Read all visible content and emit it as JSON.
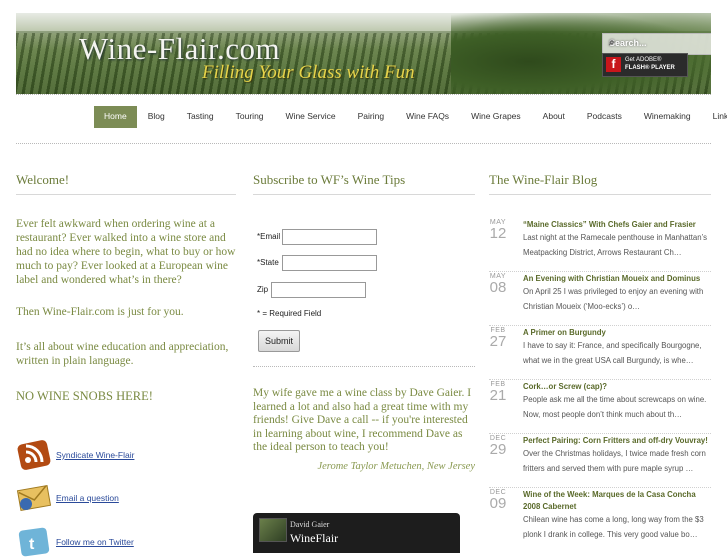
{
  "header": {
    "logo": "Wine-Flair.com",
    "tagline": "Filling Your Glass with Fun",
    "search_placeholder": "Search...",
    "flash_line1": "Get ADOBE®",
    "flash_line2": "FLASH® PLAYER"
  },
  "nav": [
    "Home",
    "Blog",
    "Tasting",
    "Touring",
    "Wine Service",
    "Pairing",
    "Wine FAQs",
    "Wine Grapes",
    "About",
    "Podcasts",
    "Winemaking",
    "Links"
  ],
  "welcome": {
    "heading": "Welcome!",
    "p1": "Ever felt awkward when ordering wine at a restaurant? Ever walked into a wine store and had no idea where to begin, what to buy or how much to pay? Ever looked at a European wine label and wondered what’s in there?",
    "p2": "Then Wine-Flair.com is just for you.",
    "p3": "It’s all about wine education and appreciation, written in plain language.",
    "p4": "NO WINE SNOBS HERE!",
    "links": [
      "Syndicate Wine-Flair",
      "Email a question",
      "Follow me on Twitter"
    ]
  },
  "subscribe": {
    "heading": "Subscribe to WF’s Wine Tips",
    "email_label": "*Email",
    "state_label": "*State",
    "zip_label": "Zip",
    "required_note": "* = Required Field",
    "submit": "Submit"
  },
  "testimonial": {
    "quote": "My wife gave me a wine class by Dave Gaier. I learned a lot and also had a great time with my friends! Give Dave a call -- if you're interested in learning about wine, I recommend Dave as the ideal person to teach you!",
    "source": "Jerome Taylor Metuchen, New Jersey"
  },
  "video": {
    "user": "David Gaier",
    "channel": "WineFlair"
  },
  "blog": {
    "heading": "The Wine-Flair Blog",
    "posts": [
      {
        "month": "MAY",
        "day": "12",
        "title": "“Maine Classics” With Chefs Gaier and Frasier",
        "excerpt": "Last night at the Ramecale penthouse in Manhattan’s Meatpacking District, Arrows Restaurant Ch…"
      },
      {
        "month": "MAY",
        "day": "08",
        "title": "An Evening with Christian Moueix and Dominus",
        "excerpt": "On April 25 I was privileged to enjoy an evening with Christian Moueix (‘Moo-ecks’) o…"
      },
      {
        "month": "FEB",
        "day": "27",
        "title": "A Primer on Burgundy",
        "excerpt": "I have to say it: France, and specifically Bourgogne, what we in the great USA call Burgundy, is whe…"
      },
      {
        "month": "FEB",
        "day": "21",
        "title": "Cork…or Screw (cap)?",
        "excerpt": "People ask me all the time about screwcaps on wine. Now, most people don’t think much about th…"
      },
      {
        "month": "DEC",
        "day": "29",
        "title": "Perfect Pairing: Corn Fritters and off-dry Vouvray!",
        "excerpt": "Over the Christmas holidays, I twice made fresh corn fritters and served them with pure maple syrup …"
      },
      {
        "month": "DEC",
        "day": "09",
        "title": "Wine of the Week: Marques de la Casa Concha 2008 Cabernet",
        "excerpt": "Chilean wine has come a long, long way from the $3 plonk I drank in college. This very good value bo…"
      }
    ]
  }
}
